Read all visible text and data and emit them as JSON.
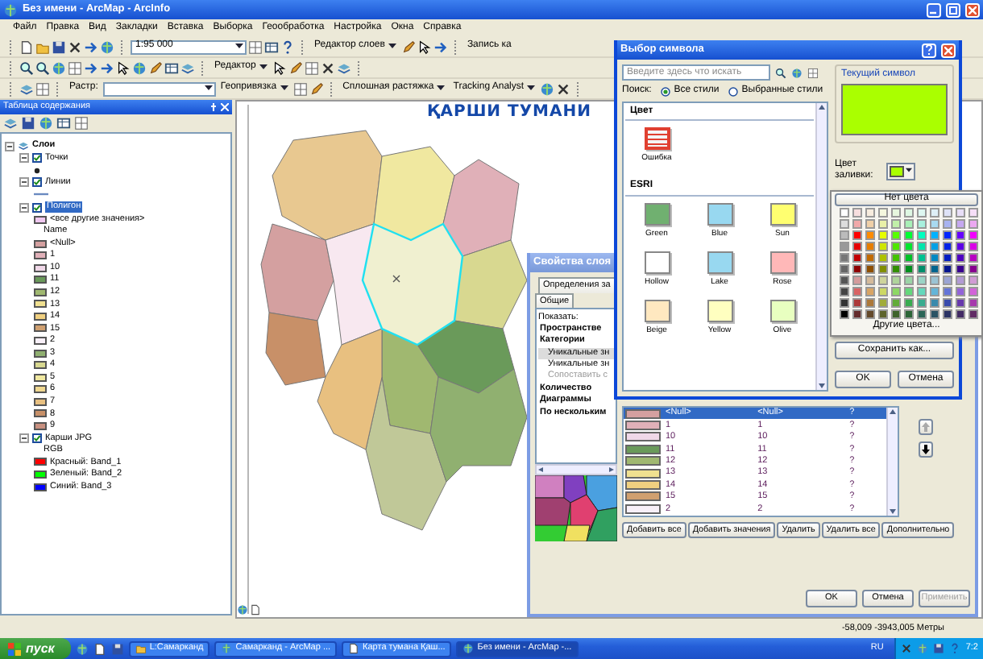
{
  "window": {
    "title": "Без имени - ArcMap - ArcInfo"
  },
  "menu": [
    "Файл",
    "Правка",
    "Вид",
    "Закладки",
    "Вставка",
    "Выборка",
    "Геообработка",
    "Настройка",
    "Окна",
    "Справка"
  ],
  "toolbars": [
    [
      {
        "kind": "tools"
      },
      {
        "kind": "combo",
        "value": "1:95 000"
      },
      {
        "kind": "tools"
      },
      {
        "kind": "dropdown",
        "label": "Редактор слоев"
      },
      {
        "kind": "tools"
      },
      {
        "kind": "label",
        "label": "Запись ка"
      }
    ],
    [
      {
        "kind": "tools"
      },
      {
        "kind": "dropdown",
        "label": "Редактор"
      },
      {
        "kind": "tools"
      }
    ],
    [
      {
        "kind": "tools"
      },
      {
        "kind": "label",
        "label": "Растр:"
      },
      {
        "kind": "field"
      },
      {
        "kind": "dropdown",
        "label": "Геопривязка"
      },
      {
        "kind": "tools"
      },
      {
        "kind": "dropdown",
        "label": "Сплошная растяжка"
      },
      {
        "kind": "dropdown",
        "label": "Tracking Analyst"
      },
      {
        "kind": "tools"
      }
    ]
  ],
  "toc": {
    "title": "Таблица содержания",
    "tree": [
      {
        "kind": "group",
        "label": "Слои",
        "expanded": true,
        "children": [
          {
            "kind": "layer",
            "label": "Точки",
            "checked": true,
            "expanded": true,
            "selected": false,
            "children": [
              {
                "kind": "point"
              }
            ]
          },
          {
            "kind": "layer",
            "label": "Линии",
            "checked": true,
            "expanded": true,
            "selected": false,
            "children": [
              {
                "kind": "line"
              }
            ]
          },
          {
            "kind": "layer",
            "label": "Полигон",
            "checked": true,
            "expanded": true,
            "selected": true,
            "children": [
              {
                "kind": "swatch",
                "label": "<все другие значения>",
                "color": "#f0c8f0"
              },
              {
                "kind": "heading",
                "label": "Name"
              },
              {
                "kind": "swatch",
                "label": "<Null>",
                "color": "#d4a0a0"
              },
              {
                "kind": "swatch",
                "label": "1",
                "color": "#e0b0b8"
              },
              {
                "kind": "swatch",
                "label": "10",
                "color": "#f0d8e8"
              },
              {
                "kind": "swatch",
                "label": "11",
                "color": "#6a9a5a"
              },
              {
                "kind": "swatch",
                "label": "12",
                "color": "#a0b870"
              },
              {
                "kind": "swatch",
                "label": "13",
                "color": "#f0e090"
              },
              {
                "kind": "swatch",
                "label": "14",
                "color": "#f0d080"
              },
              {
                "kind": "swatch",
                "label": "15",
                "color": "#d0a070"
              },
              {
                "kind": "swatch",
                "label": "2",
                "color": "#f8f0f8"
              },
              {
                "kind": "swatch",
                "label": "3",
                "color": "#90b070"
              },
              {
                "kind": "swatch",
                "label": "4",
                "color": "#d8d890"
              },
              {
                "kind": "swatch",
                "label": "5",
                "color": "#f0e8a0"
              },
              {
                "kind": "swatch",
                "label": "6",
                "color": "#f0d890"
              },
              {
                "kind": "swatch",
                "label": "7",
                "color": "#e8c080"
              },
              {
                "kind": "swatch",
                "label": "8",
                "color": "#c89068"
              },
              {
                "kind": "swatch",
                "label": "9",
                "color": "#c89080"
              }
            ]
          },
          {
            "kind": "layer",
            "label": "Карши JPG",
            "checked": true,
            "expanded": true,
            "selected": false,
            "children": [
              {
                "kind": "heading",
                "label": "RGB"
              },
              {
                "kind": "swatch",
                "label": "Красный: Band_1",
                "color": "#ff0000"
              },
              {
                "kind": "swatch",
                "label": "Зеленый: Band_2",
                "color": "#00ff00"
              },
              {
                "kind": "swatch",
                "label": "Синий: Band_3",
                "color": "#0000ff"
              }
            ]
          }
        ]
      }
    ]
  },
  "map": {
    "title": "ҚАРШИ ТУМАНИ"
  },
  "status_bar": {
    "coordinates": "-58,009 -3943,005 Метры"
  },
  "symbol_dialog": {
    "title": "Выбор символа",
    "search": {
      "placeholder": "Введите здесь что искать"
    },
    "search_label": "Поиск:",
    "radios": [
      {
        "label": "Все стили",
        "selected": true
      },
      {
        "label": "Выбранные стили",
        "selected": false
      }
    ],
    "sections": [
      {
        "title": "Цвет",
        "items": [
          {
            "label": "Ошибка",
            "color": "#e04030",
            "kind": "stripes"
          }
        ]
      },
      {
        "title": "ESRI",
        "items": [
          {
            "label": "Green",
            "color": "#70b070",
            "kind": "fill"
          },
          {
            "label": "Blue",
            "color": "#98d8f0",
            "kind": "fill"
          },
          {
            "label": "Sun",
            "color": "#ffff70",
            "kind": "fill"
          },
          {
            "label": "Hollow",
            "color": "#ffffff",
            "kind": "fill"
          },
          {
            "label": "Lake",
            "color": "#98d8f0",
            "kind": "fill"
          },
          {
            "label": "Rose",
            "color": "#ffb8b8",
            "kind": "fill"
          },
          {
            "label": "Beige",
            "color": "#ffe8c0",
            "kind": "fill"
          },
          {
            "label": "Yellow",
            "color": "#ffffc0",
            "kind": "fill"
          },
          {
            "label": "Olive",
            "color": "#e8ffc0",
            "kind": "fill"
          }
        ]
      }
    ],
    "current": {
      "title": "Текущий символ",
      "color": "#aaff00"
    },
    "fill_label": "Цвет заливки:",
    "buttons": [
      "Сохранить как...",
      "OK",
      "Отмена"
    ]
  },
  "palette": {
    "no_color": "Нет цвета",
    "more": "Другие цвета..."
  },
  "layer_dialog": {
    "title": "Свойства слоя",
    "tabs": [
      {
        "label": "Определения за",
        "selected": false
      },
      {
        "label": "Общие",
        "selected": false
      }
    ],
    "show_label": "Показать:",
    "categories": [
      {
        "label": "Пространстве",
        "selected": false
      },
      {
        "label": "Категории",
        "selected": false,
        "children": [
          {
            "label": "Уникальные зн",
            "selected": true,
            "disabled": false
          },
          {
            "label": "Уникальные зн",
            "selected": false,
            "disabled": false
          },
          {
            "label": "Сопоставить с",
            "selected": false,
            "disabled": true
          }
        ]
      },
      {
        "label": "Количество",
        "selected": false
      },
      {
        "label": "Диаграммы",
        "selected": false
      },
      {
        "label": "По нескольким",
        "selected": false
      }
    ],
    "rows": [
      {
        "color": "#d4a0a0",
        "value": "<Null>",
        "label": "<Null>",
        "count": "?",
        "selected": true
      },
      {
        "color": "#e0b0b8",
        "value": "1",
        "label": "1",
        "count": "?",
        "selected": false
      },
      {
        "color": "#f0d8e8",
        "value": "10",
        "label": "10",
        "count": "?",
        "selected": false
      },
      {
        "color": "#6a9a5a",
        "value": "11",
        "label": "11",
        "count": "?",
        "selected": false
      },
      {
        "color": "#a0b870",
        "value": "12",
        "label": "12",
        "count": "?",
        "selected": false
      },
      {
        "color": "#f0e090",
        "value": "13",
        "label": "13",
        "count": "?",
        "selected": false
      },
      {
        "color": "#f0d080",
        "value": "14",
        "label": "14",
        "count": "?",
        "selected": false
      },
      {
        "color": "#d0a070",
        "value": "15",
        "label": "15",
        "count": "?",
        "selected": false
      },
      {
        "color": "#f8f0f8",
        "value": "2",
        "label": "2",
        "count": "?",
        "selected": false
      }
    ],
    "buttons": [
      "Добавить все",
      "Добавить значения",
      "Удалить",
      "Удалить все",
      "Дополнительно"
    ],
    "footer": [
      {
        "label": "OK",
        "disabled": false
      },
      {
        "label": "Отмена",
        "disabled": false
      },
      {
        "label": "Применить",
        "disabled": true
      }
    ]
  },
  "taskbar": {
    "start": "пуск",
    "tasks": [
      {
        "label": "L:Самарканд",
        "selected": false
      },
      {
        "label": "Самарканд - ArcMap ...",
        "selected": false
      },
      {
        "label": "Карта тумана Қаш...",
        "selected": false
      },
      {
        "label": "Без имени - ArcMap -...",
        "selected": true
      }
    ],
    "language": "RU",
    "clock": "7:2"
  }
}
